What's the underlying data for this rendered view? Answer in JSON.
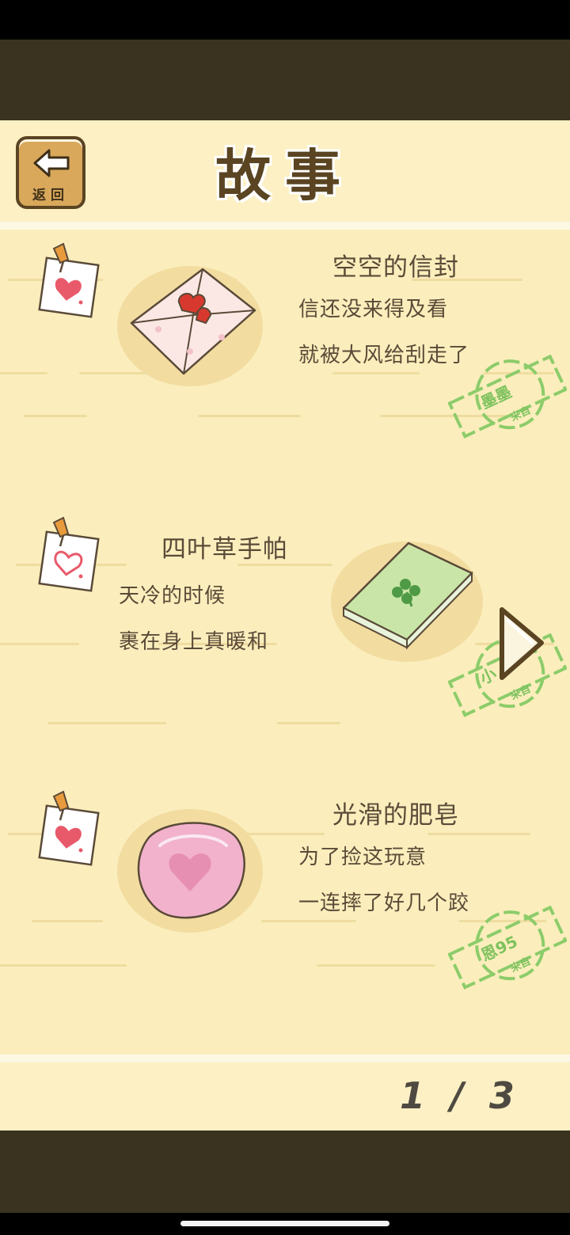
{
  "header": {
    "back_label": "返回",
    "title": "故事"
  },
  "entries": [
    {
      "title": "空空的信封",
      "lines": [
        "信还没来得及看",
        "就被大风给刮走了"
      ],
      "icon": "envelope-icon",
      "stamp_name": "墨墨",
      "stamp_sub": "来自"
    },
    {
      "title": "四叶草手帕",
      "lines": [
        "天冷的时候",
        "裹在身上真暖和"
      ],
      "icon": "handkerchief-icon",
      "stamp_name": "小",
      "stamp_sub": "来自"
    },
    {
      "title": "光滑的肥皂",
      "lines": [
        "为了捡这玩意",
        "一连摔了好几个跤"
      ],
      "icon": "soap-icon",
      "stamp_name": "恩95",
      "stamp_sub": "来自"
    }
  ],
  "pagination": {
    "current": "1",
    "separator": "/",
    "total": "3"
  },
  "colors": {
    "panel": "#fbeebc",
    "dark_band": "#3a3320",
    "text": "#5a4a38",
    "stamp_green": "#7fc25e",
    "heart_red": "#e85a6a"
  }
}
